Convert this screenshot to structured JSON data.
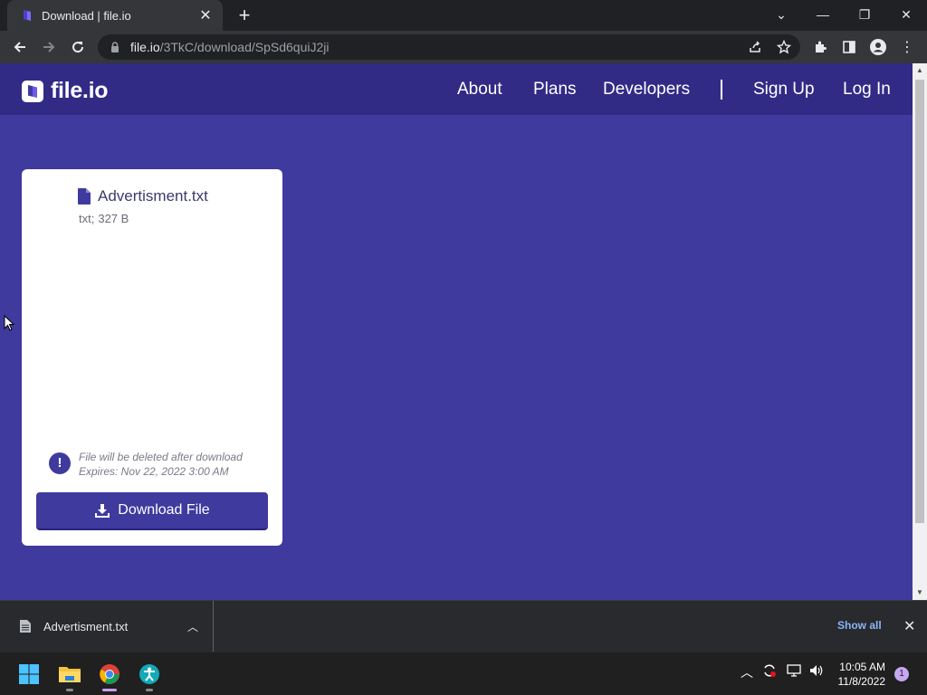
{
  "browser": {
    "tab_title": "Download | file.io",
    "url_host": "file.io",
    "url_path": "/3TkC/download/SpSd6quiJ2ji"
  },
  "site": {
    "brand": "file.io",
    "nav": {
      "about": "About",
      "plans": "Plans",
      "developers": "Developers",
      "signup": "Sign Up",
      "login": "Log In"
    }
  },
  "file": {
    "name": "Advertisment.txt",
    "type": "txt;",
    "size": "327 B",
    "notice_line1": "File will be deleted after download",
    "notice_line2": "Expires: Nov 22, 2022 3:00 AM",
    "download_label": "Download File"
  },
  "download_shelf": {
    "item_name": "Advertisment.txt",
    "show_all": "Show all"
  },
  "taskbar": {
    "time": "10:05 AM",
    "date": "11/8/2022",
    "notification_count": "1"
  },
  "colors": {
    "page_bg": "#3f3a9e",
    "header_bg": "#312b86",
    "accent": "#3f3a9e"
  }
}
